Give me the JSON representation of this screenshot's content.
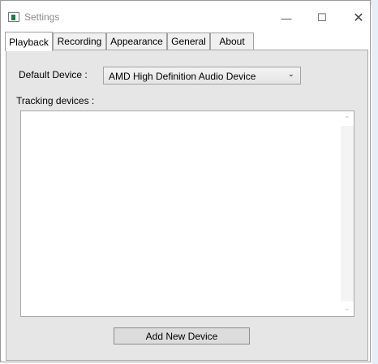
{
  "window": {
    "title": "Settings",
    "controls": {
      "minimize": "—",
      "maximize": "☐",
      "close": "✕"
    }
  },
  "tabs": [
    {
      "label": "Playback",
      "active": true
    },
    {
      "label": "Recording",
      "active": false
    },
    {
      "label": "Appearance",
      "active": false
    },
    {
      "label": "General",
      "active": false
    },
    {
      "label": "About",
      "active": false
    }
  ],
  "playback": {
    "default_device_label": "Default Device :",
    "default_device_value": "AMD High Definition Audio Device",
    "tracking_devices_label": "Tracking devices :",
    "tracking_devices": [],
    "add_button_label": "Add New Device"
  },
  "icons": {
    "app": "settings-app-icon",
    "dropdown": "chevron-down-icon",
    "scroll_up": "chevron-up-icon",
    "scroll_down": "chevron-down-icon"
  }
}
